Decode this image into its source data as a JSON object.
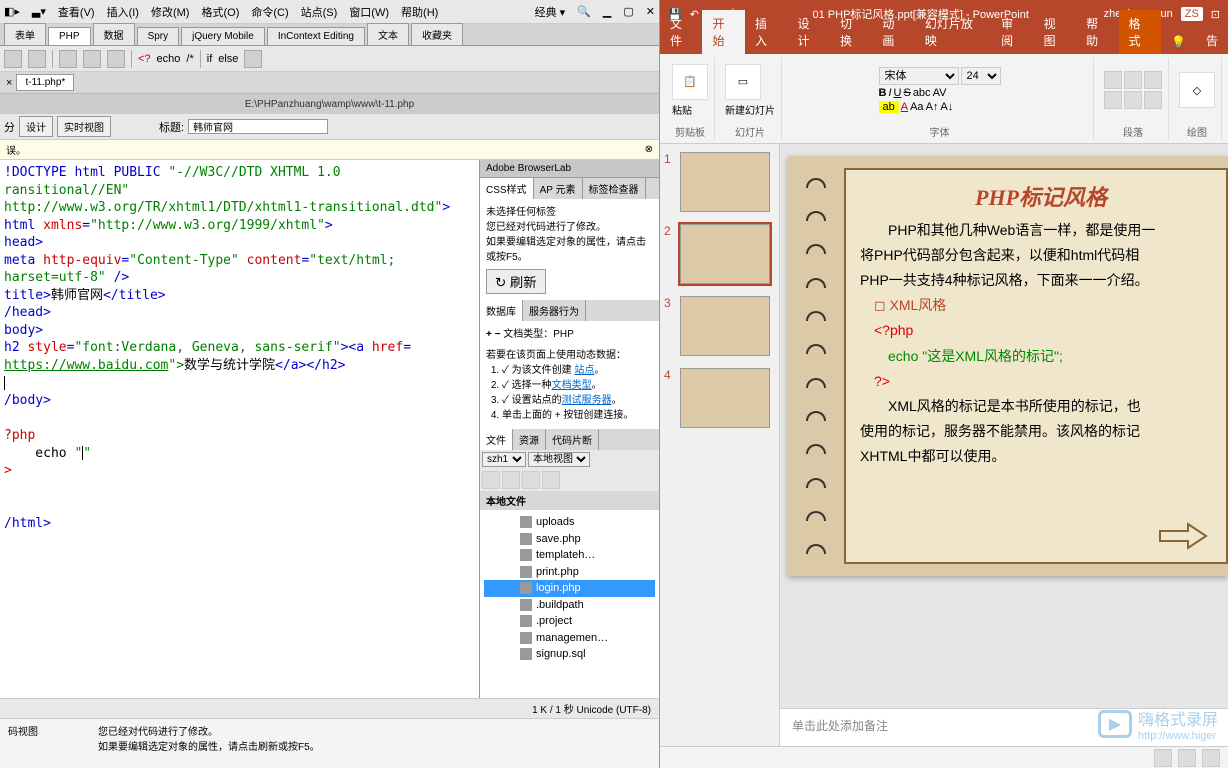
{
  "dw": {
    "dropdown": "经典 ▾",
    "menubar": [
      "查看(V)",
      "插入(I)",
      "修改(M)",
      "格式(O)",
      "命令(C)",
      "站点(S)",
      "窗口(W)",
      "帮助(H)"
    ],
    "doc_tabs": [
      "表单",
      "PHP",
      "数据",
      "Spry",
      "jQuery Mobile",
      "InContext Editing",
      "文本",
      "收藏夹"
    ],
    "tool_labels": {
      "echo": "echo",
      "if": "if",
      "else": "else"
    },
    "filetab": "t-11.php*",
    "filepath": "E:\\PHPanzhuang\\wamp\\www\\t-11.php",
    "view_buttons": {
      "design": "设计",
      "live": "实时视图"
    },
    "title_label": "标题:",
    "title_value": "韩师官网",
    "error_text": "误。",
    "code": {
      "l1a": "!DOCTYPE html PUBLIC ",
      "l1b": "\"-//W3C//DTD XHTML 1.0 ",
      "l2": "ransitional//EN\"",
      "l3": "http://www.w3.org/TR/xhtml1/DTD/xhtml1-transitional.dtd\"",
      "l4a": "html ",
      "l4b": "xmlns",
      "l4c": "=",
      "l4d": "\"http://www.w3.org/1999/xhtml\"",
      "l5": "head>",
      "l6a": "meta ",
      "l6b": "http-equiv",
      "l6c": "=",
      "l6d": "\"Content-Type\"",
      "l6e": " content",
      "l6f": "=",
      "l6g": "\"text/html; ",
      "l7": "harset=utf-8\" ",
      "l8a": "title>",
      "l8b": "韩师官网",
      "l8c": "</",
      "l8d": "title>",
      "l9": "/head>",
      "l10": "body>",
      "l11a": "h2 ",
      "l11b": "style",
      "l11c": "=",
      "l11d": "\"font:Verdana, Geneva, sans-serif\"",
      "l11e": "><",
      "l11f": "a ",
      "l11g": "href",
      "l11h": "=",
      "l12a": "https://www.baidu.com",
      "l12b": "\">",
      "l12c": "数学与统计学院",
      "l12d": "</",
      "l12e": "a></",
      "l12f": "h2>",
      "l13": "/body>",
      "l14": "?php",
      "l15a": "    echo ",
      "l15b": "\"",
      "l15c": "\"",
      "l16": ">",
      "l17": "/html>"
    },
    "status": "1 K / 1 秒 Unicode (UTF-8)",
    "bottom": {
      "left": "码视图",
      "r1": "您已经对代码进行了修改。",
      "r2": "如果要编辑选定对象的属性，请点击刷新或按F5。"
    },
    "right": {
      "browserlab": "Adobe BrowserLab",
      "css_tabs": [
        "CSS样式",
        "AP 元素",
        "标签检查器"
      ],
      "css_body": {
        "line1": "未选择任何标签",
        "line2": "您已经对代码进行了修改。",
        "line3": "如果要编辑选定对象的属性，请点击或按F5。",
        "refresh": "刷新"
      },
      "db_tabs": [
        "数据库",
        "服务器行为"
      ],
      "doc_type": "文档类型：PHP",
      "inst_head": "若要在该页面上使用动态数据：",
      "inst1a": "为该文件创建",
      "inst1b": "站点",
      "inst1c": "。",
      "inst2a": "选择一种",
      "inst2b": "文档类型",
      "inst2c": "。",
      "inst3a": "设置站点的",
      "inst3b": "测试服务器",
      "inst3c": "。",
      "inst4": "单击上面的 + 按钮创建连接。",
      "file_tabs": [
        "文件",
        "资源",
        "代码片断"
      ],
      "site_sel": "szh1",
      "view_sel": "本地视图",
      "file_head": "本地文件",
      "files": [
        "uploads",
        "save.php",
        "templateh…",
        "print.php",
        "login.php",
        ".buildpath",
        ".project",
        "managemen…",
        "signup.sql"
      ]
    }
  },
  "pp": {
    "title": "01  PHP标记风格.ppt[兼容模式] - PowerPoint",
    "user": "zhenhang sun",
    "user_badge": "ZS",
    "tabs": [
      "文件",
      "开始",
      "插入",
      "设计",
      "切换",
      "动画",
      "幻灯片放映",
      "审阅",
      "视图",
      "帮助",
      "格式",
      "告"
    ],
    "ribbon": {
      "clipboard": "剪贴板",
      "paste": "粘贴",
      "slides": "幻灯片",
      "newslide": "新建幻灯片",
      "font": "字体",
      "fontname": "宋体",
      "fontsize": "24",
      "para": "段落",
      "draw": "绘图"
    },
    "thumbs": [
      "1",
      "2",
      "3",
      "4"
    ],
    "slide": {
      "title": "PHP标记风格",
      "p1": "PHP和其他几种Web语言一样，都是使用一",
      "p2": "将PHP代码部分包含起来，以便和html代码相",
      "p3": "PHP一共支持4种标记风格，下面来一一介绍。",
      "bullet": "◻    XML风格",
      "code1": "<?php",
      "code2": "echo \"这是XML风格的标记\";",
      "code3": "?>",
      "p4": "XML风格的标记是本书所使用的标记，也",
      "p5": "使用的标记，服务器不能禁用。该风格的标记",
      "p6": "XHTML中都可以使用。"
    },
    "notes": "单击此处添加备注",
    "watermark": "嗨格式录屏",
    "watermark_url": "http://www.higer"
  }
}
